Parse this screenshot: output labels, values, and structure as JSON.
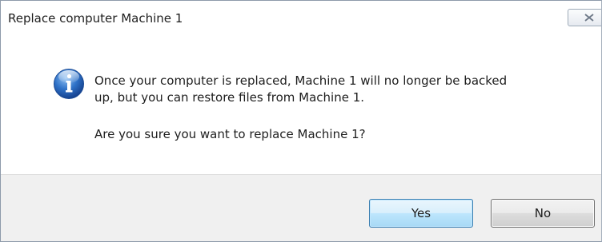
{
  "dialog": {
    "title": "Replace computer Machine 1",
    "icon": "info-icon",
    "message_line1": "Once your computer is replaced, Machine 1 will no longer be backed",
    "message_line2": "up, but you can restore files from Machine 1.",
    "question": "Are you sure you want to replace Machine 1?"
  },
  "buttons": {
    "yes_label": "Yes",
    "no_label": "No"
  },
  "colors": {
    "footer_bg": "#f0f0f0",
    "default_button_border": "#3c7fb1",
    "info_icon_blue": "#1f5fb5"
  }
}
